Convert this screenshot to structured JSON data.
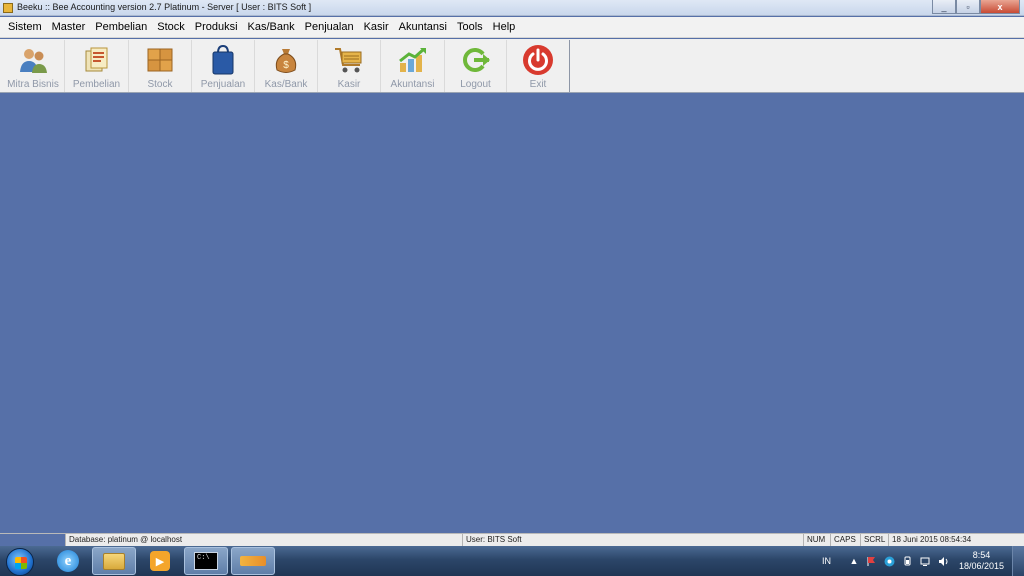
{
  "window": {
    "title": "Beeku :: Bee Accounting version 2.7 Platinum - Server  [ User : BITS Soft ]",
    "controls": {
      "minimize": "_",
      "restore": "▫",
      "close": "x"
    }
  },
  "menu": [
    {
      "label": "Sistem"
    },
    {
      "label": "Master"
    },
    {
      "label": "Pembelian"
    },
    {
      "label": "Stock"
    },
    {
      "label": "Produksi"
    },
    {
      "label": "Kas/Bank"
    },
    {
      "label": "Penjualan"
    },
    {
      "label": "Kasir"
    },
    {
      "label": "Akuntansi"
    },
    {
      "label": "Tools"
    },
    {
      "label": "Help"
    }
  ],
  "toolbar": [
    {
      "label": "Mitra Bisnis",
      "icon": "people-icon"
    },
    {
      "label": "Pembelian",
      "icon": "purchase-documents-icon"
    },
    {
      "label": "Stock",
      "icon": "boxes-icon"
    },
    {
      "label": "Penjualan",
      "icon": "shopping-bag-icon"
    },
    {
      "label": "Kas/Bank",
      "icon": "money-bag-icon"
    },
    {
      "label": "Kasir",
      "icon": "shopping-cart-icon"
    },
    {
      "label": "Akuntansi",
      "icon": "chart-up-icon"
    },
    {
      "label": "Logout",
      "icon": "logout-arrow-icon"
    },
    {
      "label": "Exit",
      "icon": "power-icon"
    }
  ],
  "statusbar": {
    "database": "Database: platinum @ localhost",
    "user": "User: BITS Soft",
    "num": "NUM",
    "caps": "CAPS",
    "scrl": "SCRL",
    "datetime": "18 Juni 2015  08:54:34"
  },
  "taskbar": {
    "language": "IN",
    "time": "8:54",
    "date": "18/06/2015",
    "tray_arrow": "▲"
  },
  "colors": {
    "workspace": "#5670a8",
    "toolbar_label": "#8f98a8"
  }
}
